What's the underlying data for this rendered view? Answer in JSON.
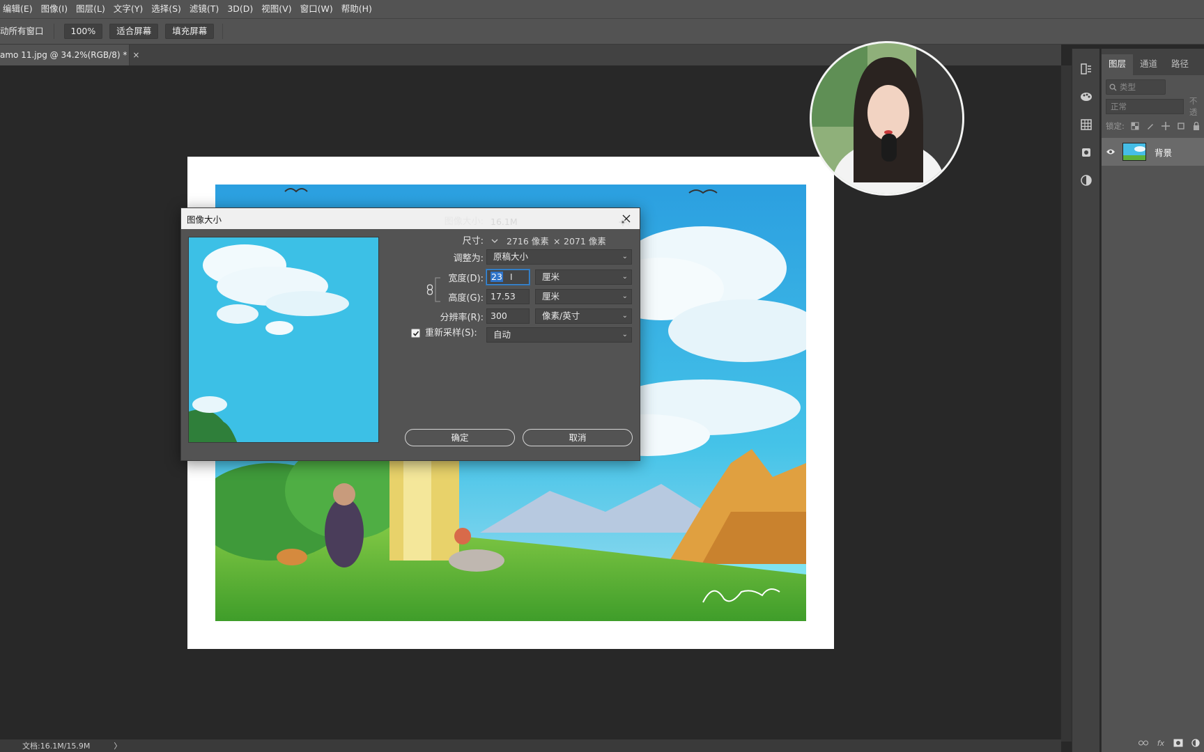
{
  "menubar": {
    "items": [
      "编辑(E)",
      "图像(I)",
      "图层(L)",
      "文字(Y)",
      "选择(S)",
      "滤镜(T)",
      "3D(D)",
      "视图(V)",
      "窗口(W)",
      "帮助(H)"
    ]
  },
  "options": {
    "scroll_all": "动所有窗口",
    "zoom_btn": "100%",
    "fit_btn": "适合屏幕",
    "fill_btn": "填充屏幕"
  },
  "document": {
    "tab_title": "amo 11.jpg @ 34.2%(RGB/8) *",
    "tab_close": "×"
  },
  "status": {
    "doc_info": "文档:16.1M/15.9M",
    "arrow": "〉"
  },
  "layers_panel": {
    "tabs": [
      "图层",
      "通道",
      "路径"
    ],
    "search_placeholder": "类型",
    "blend_mode": "正常",
    "opacity_label": "不透",
    "lock_label": "锁定:",
    "layer_name": "背景",
    "footer_fx": "fx"
  },
  "dialog": {
    "title": "图像大小",
    "image_size_label": "图像大小:",
    "image_size_value": "16.1M",
    "dimensions_label": "尺寸:",
    "dim_width": "2716 像素",
    "dim_times": "×",
    "dim_height": "2071 像素",
    "fit_to_label": "调整为:",
    "fit_to_value": "原稿大小",
    "width_label": "宽度(D):",
    "width_value": "23",
    "width_unit": "厘米",
    "height_label": "高度(G):",
    "height_value": "17.53",
    "height_unit": "厘米",
    "resolution_label": "分辨率(R):",
    "resolution_value": "300",
    "resolution_unit": "像素/英寸",
    "resample_label": "重新采样(S):",
    "resample_checked": true,
    "resample_value": "自动",
    "ok": "确定",
    "cancel": "取消"
  },
  "colors": {
    "ui_dark": "#282828",
    "ui_panel": "#535353",
    "focus_blue": "#2f74c9",
    "sky": "#3fc2e6"
  }
}
